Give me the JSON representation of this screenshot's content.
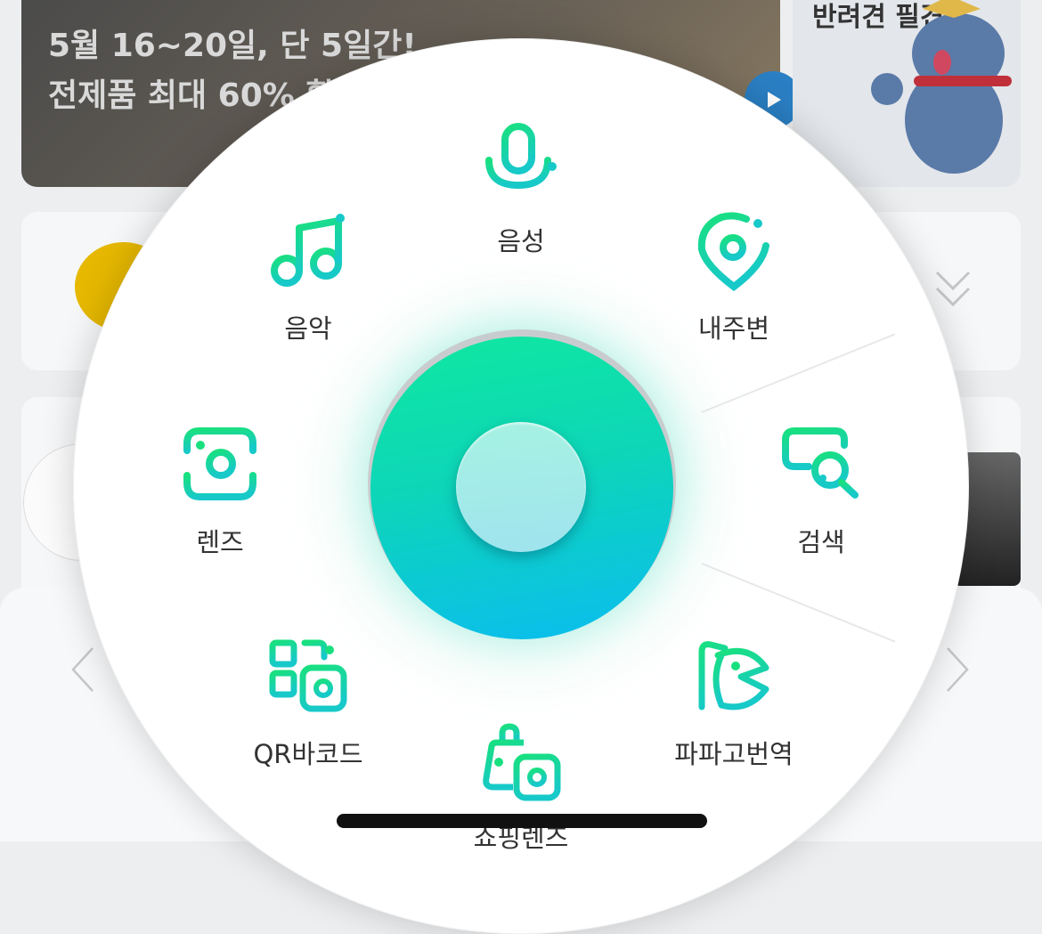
{
  "background": {
    "banner": {
      "line1": "5월 16~20일, 단 5일간!",
      "line2": "전제품 최대 60% 할"
    },
    "side_card": {
      "title": "반려견 필견!"
    }
  },
  "dial": {
    "items": [
      {
        "id": "voice",
        "label": "음성",
        "icon": "microphone-icon"
      },
      {
        "id": "music",
        "label": "음악",
        "icon": "music-note-icon"
      },
      {
        "id": "nearby",
        "label": "내주변",
        "icon": "map-pin-icon"
      },
      {
        "id": "lens",
        "label": "렌즈",
        "icon": "camera-lens-icon"
      },
      {
        "id": "search",
        "label": "검색",
        "icon": "search-image-icon"
      },
      {
        "id": "qr",
        "label": "QR바코드",
        "icon": "qr-code-icon"
      },
      {
        "id": "papago",
        "label": "파파고번역",
        "icon": "papago-icon"
      },
      {
        "id": "shopping",
        "label": "쇼핑렌즈",
        "icon": "shopping-bag-camera-icon"
      }
    ],
    "center": {
      "icon": "center-button"
    }
  },
  "colors": {
    "accent_green": "#10e8a0",
    "accent_blue": "#0bbcf0",
    "label": "#333333"
  }
}
